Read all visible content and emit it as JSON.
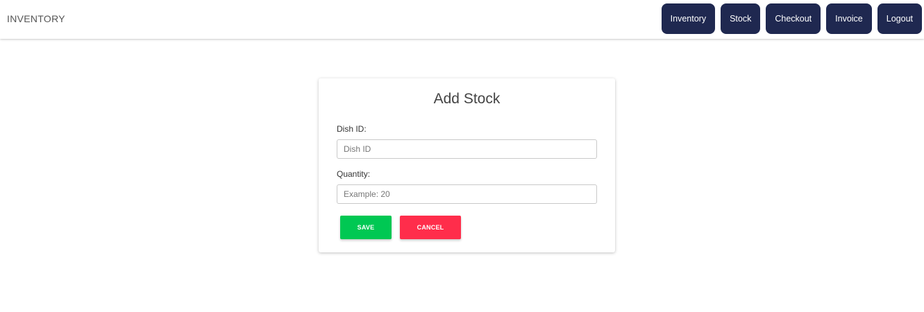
{
  "navbar": {
    "brand": "INVENTORY",
    "buttons": [
      "Inventory",
      "Stock",
      "Checkout",
      "Invoice",
      "Logout"
    ]
  },
  "form": {
    "title": "Add Stock",
    "dish_id": {
      "label": "Dish ID:",
      "placeholder": "Dish ID",
      "value": ""
    },
    "quantity": {
      "label": "Quantity:",
      "placeholder": "Example: 20",
      "value": ""
    },
    "save_label": "SAVE",
    "cancel_label": "CANCEL"
  },
  "colors": {
    "nav_button": "#1f2850",
    "save": "#00c853",
    "cancel": "#ff2d4b"
  }
}
